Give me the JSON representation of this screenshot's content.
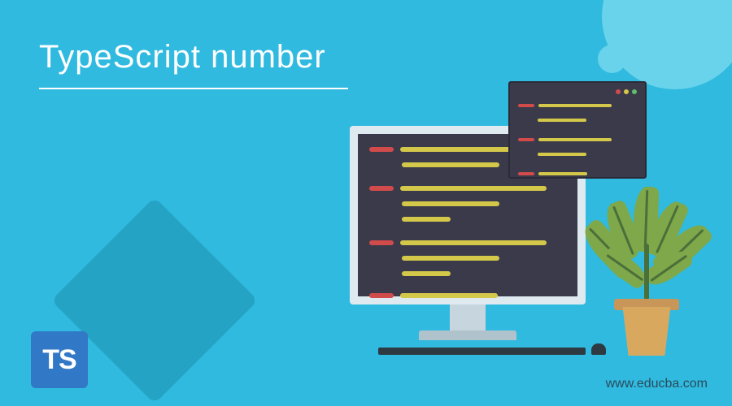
{
  "title": "TypeScript number",
  "footer_url": "www.educba.com",
  "ts_logo_text": "TS"
}
